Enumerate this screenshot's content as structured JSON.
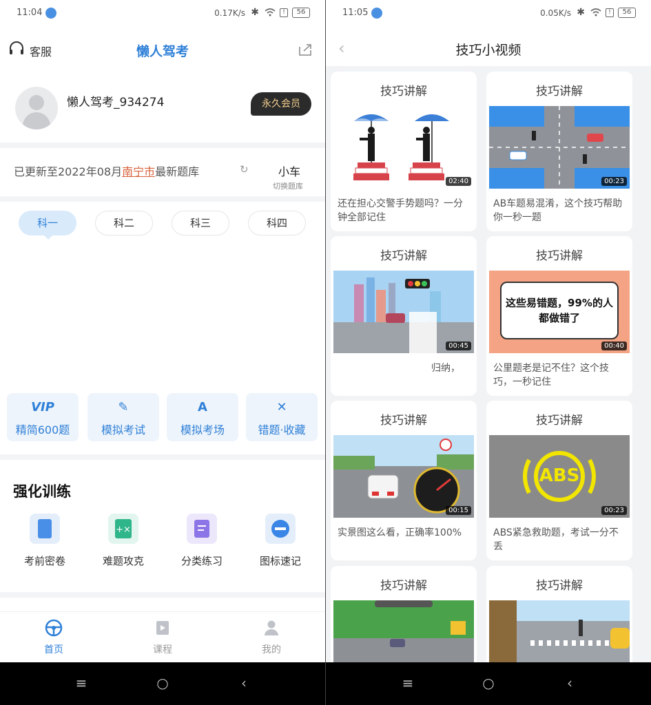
{
  "left": {
    "status": {
      "time": "11:04",
      "speed": "0.17K/s",
      "battery": "56"
    },
    "header": {
      "service_label": "客服",
      "title": "懒人驾考"
    },
    "profile": {
      "username": "懒人驾考_934274",
      "vip_label": "永久会员"
    },
    "bank": {
      "prefix": "已更新至2022年08月",
      "city": "南宁市",
      "suffix": "最新题库",
      "car_type": "小车",
      "switch_label": "切换题库"
    },
    "subjects": [
      "科一",
      "科二",
      "科三",
      "科四"
    ],
    "quick_actions": [
      {
        "icon": "VIP",
        "label": "精简600题"
      },
      {
        "icon": "✎",
        "label": "模拟考试"
      },
      {
        "icon": "A",
        "label": "模拟考场"
      },
      {
        "icon": "✕",
        "label": "错题·收藏"
      }
    ],
    "training": {
      "title": "强化训练",
      "items": [
        {
          "label": "考前密卷",
          "color": "#e4eefb"
        },
        {
          "label": "难题攻克",
          "color": "#e2f5ee"
        },
        {
          "label": "分类练习",
          "color": "#ece7fb"
        },
        {
          "label": "图标速记",
          "color": "#e4eefb"
        }
      ]
    },
    "tabs": [
      {
        "label": "首页",
        "active": true
      },
      {
        "label": "课程",
        "active": false
      },
      {
        "label": "我的",
        "active": false
      }
    ],
    "nav_buttons": [
      "≡",
      "○",
      "‹"
    ]
  },
  "right": {
    "status": {
      "time": "11:05",
      "speed": "0.05K/s",
      "battery": "56"
    },
    "header": {
      "title": "技巧小视频"
    },
    "card_heading": "技巧讲解",
    "videos": [
      {
        "duration": "02:40",
        "caption": "还在担心交警手势题吗？一分钟全部记住"
      },
      {
        "duration": "00:23",
        "caption": "AB车题易混淆，这个技巧帮助你一秒一题"
      },
      {
        "duration": "00:45",
        "caption": "归纳，"
      },
      {
        "duration": "00:40",
        "caption": "公里题老是记不住？这个技巧，一秒记住",
        "thumb_text": "这些易错题，99%的人都做错了"
      },
      {
        "duration": "00:15",
        "caption": "实景图这么看，正确率100%"
      },
      {
        "duration": "00:23",
        "caption": "ABS紧急救助题，考试一分不丢",
        "thumb_text": "ABS"
      },
      {
        "duration": "",
        "caption": ""
      },
      {
        "duration": "",
        "caption": ""
      }
    ],
    "nav_buttons": [
      "≡",
      "○",
      "‹"
    ]
  }
}
